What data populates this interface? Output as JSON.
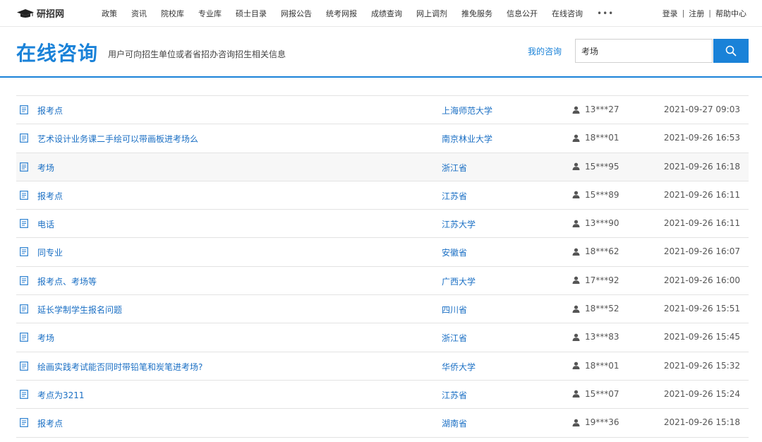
{
  "brand": {
    "name": "研招网"
  },
  "nav": [
    "政策",
    "资讯",
    "院校库",
    "专业库",
    "硕士目录",
    "网报公告",
    "统考网报",
    "成绩查询",
    "网上调剂",
    "推免服务",
    "信息公开",
    "在线咨询"
  ],
  "nav_more": "•••",
  "top_links": {
    "login": "登录",
    "register": "注册",
    "help": "帮助中心",
    "sep": "|"
  },
  "header": {
    "title": "在线咨询",
    "subtitle": "用户可向招生单位或者省招办咨询招生相关信息",
    "my_consult": "我的咨询"
  },
  "search": {
    "value": "考场"
  },
  "colors": {
    "accent": "#1a82d8",
    "link": "#1a6fc4"
  },
  "rows": [
    {
      "question": "报考点",
      "institution": "上海师范大学",
      "user": "13***27",
      "time": "2021-09-27 09:03"
    },
    {
      "question": "艺术设计业务课二手绘可以带画板进考场么",
      "institution": "南京林业大学",
      "user": "18***01",
      "time": "2021-09-26 16:53"
    },
    {
      "question": "考场",
      "institution": "浙江省",
      "user": "15***95",
      "time": "2021-09-26 16:18"
    },
    {
      "question": "报考点",
      "institution": "江苏省",
      "user": "15***89",
      "time": "2021-09-26 16:11"
    },
    {
      "question": "电话",
      "institution": "江苏大学",
      "user": "13***90",
      "time": "2021-09-26 16:11"
    },
    {
      "question": "同专业",
      "institution": "安徽省",
      "user": "18***62",
      "time": "2021-09-26 16:07"
    },
    {
      "question": "报考点、考场等",
      "institution": "广西大学",
      "user": "17***92",
      "time": "2021-09-26 16:00"
    },
    {
      "question": "延长学制学生报名问题",
      "institution": "四川省",
      "user": "18***52",
      "time": "2021-09-26 15:51"
    },
    {
      "question": "考场",
      "institution": "浙江省",
      "user": "13***83",
      "time": "2021-09-26 15:45"
    },
    {
      "question": "绘画实践考试能否同时带铅笔和炭笔进考场?",
      "institution": "华侨大学",
      "user": "18***01",
      "time": "2021-09-26 15:32"
    },
    {
      "question": "考点为3211",
      "institution": "江苏省",
      "user": "15***07",
      "time": "2021-09-26 15:24"
    },
    {
      "question": "报考点",
      "institution": "湖南省",
      "user": "19***36",
      "time": "2021-09-26 15:18"
    }
  ]
}
